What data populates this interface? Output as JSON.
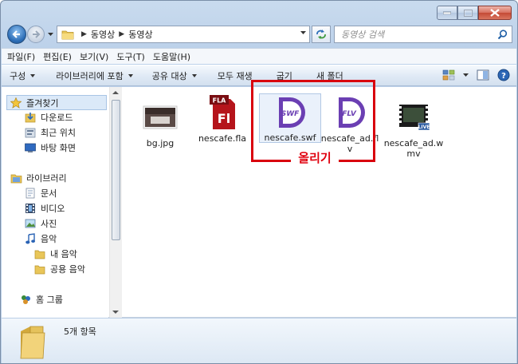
{
  "address": {
    "crumbs": [
      "동영상",
      "동영상"
    ]
  },
  "search": {
    "placeholder": "동영상 검색"
  },
  "menu": [
    "파일(F)",
    "편집(E)",
    "보기(V)",
    "도구(T)",
    "도움말(H)"
  ],
  "toolbar": {
    "organize": "구성",
    "include_library": "라이브러리에 포함",
    "share_with": "공유 대상",
    "play_all": "모두 재생",
    "burn": "굽기",
    "new_folder": "새 폴더"
  },
  "nav": {
    "favorites": "즐겨찾기",
    "downloads": "다운로드",
    "recent": "최근 위치",
    "desktop": "바탕 화면",
    "libraries": "라이브러리",
    "documents": "문서",
    "videos": "비디오",
    "pictures": "사진",
    "music": "음악",
    "my_music": "내 음악",
    "public_music": "공용 음악",
    "homegroup": "홈 그룹"
  },
  "files": [
    {
      "name": "bg.jpg",
      "icon": "image-thumbnail-icon"
    },
    {
      "name": "nescafe.fla",
      "icon": "flash-fla-icon"
    },
    {
      "name": "nescafe.swf",
      "icon": "swf-file-icon"
    },
    {
      "name": "nescafe_ad.flv",
      "icon": "flv-file-icon"
    },
    {
      "name": "nescafe_ad.wmv",
      "icon": "wmv-video-icon"
    }
  ],
  "annotation": {
    "text": "올리기",
    "color": "#d9000d"
  },
  "status": {
    "item_count": "5개 항목"
  }
}
